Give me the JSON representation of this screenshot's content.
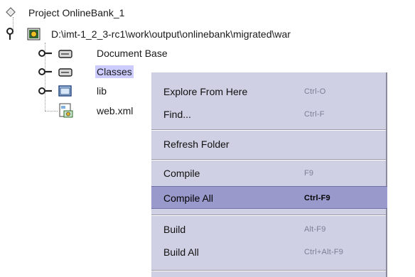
{
  "tree": {
    "project_label": "Project OnlineBank_1",
    "root_path": "D:\\imt-1_2_3-rc1\\work\\output\\onlinebank\\migrated\\war",
    "children": [
      {
        "label": "Document Base",
        "icon": "filesystem-icon",
        "expander": "key-expander-icon"
      },
      {
        "label": "Classes",
        "icon": "filesystem-icon",
        "expander": "key-expander-icon",
        "selected": true
      },
      {
        "label": "lib",
        "icon": "folder-icon",
        "expander": "key-expander-icon"
      },
      {
        "label": "web.xml",
        "icon": "xml-file-icon"
      }
    ]
  },
  "context_menu": {
    "items": [
      {
        "label": "Explore From Here",
        "shortcut": "Ctrl-O"
      },
      {
        "label": "Find...",
        "shortcut": "Ctrl-F"
      },
      {
        "label": "Refresh Folder",
        "shortcut": ""
      },
      {
        "label": "Compile",
        "shortcut": "F9"
      },
      {
        "label": "Compile All",
        "shortcut": "Ctrl-F9",
        "highlighted": true
      },
      {
        "label": "Build",
        "shortcut": "Alt-F9"
      },
      {
        "label": "Build All",
        "shortcut": "Ctrl+Alt-F9"
      }
    ]
  },
  "colors": {
    "menu_background": "#cfd0e3",
    "menu_highlight": "#9999cc",
    "selection": "#ccccff",
    "shortcut_text": "#7d7d95"
  }
}
